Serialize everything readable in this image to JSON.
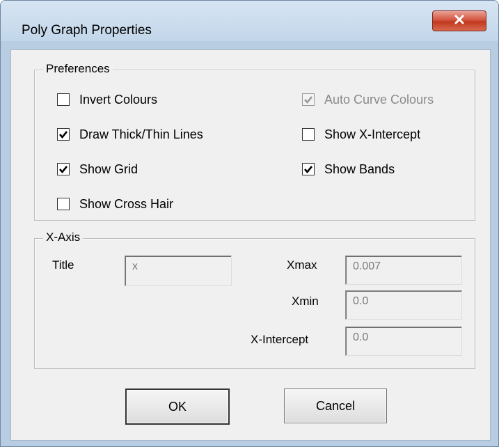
{
  "window": {
    "title": "Poly Graph Properties",
    "close_icon": "close-icon"
  },
  "preferences": {
    "legend": "Preferences",
    "checkboxes": [
      {
        "label": "Invert Colours",
        "checked": false,
        "enabled": true
      },
      {
        "label": "Draw Thick/Thin Lines",
        "checked": true,
        "enabled": true
      },
      {
        "label": "Show Grid",
        "checked": true,
        "enabled": true
      },
      {
        "label": "Show Cross Hair",
        "checked": false,
        "enabled": true
      },
      {
        "label": "Auto Curve Colours",
        "checked": true,
        "enabled": false
      },
      {
        "label": "Show X-Intercept",
        "checked": false,
        "enabled": true
      },
      {
        "label": "Show Bands",
        "checked": true,
        "enabled": true
      }
    ]
  },
  "x_axis": {
    "legend": "X-Axis",
    "title_label": "Title",
    "title_value": "x",
    "xmax_label": "Xmax",
    "xmax_value": "0.007",
    "xmin_label": "Xmin",
    "xmin_value": "0.0",
    "xintercept_label": "X-Intercept",
    "xintercept_value": "0.0"
  },
  "buttons": {
    "ok": "OK",
    "cancel": "Cancel"
  },
  "colors": {
    "close_button": "#c9452d",
    "dialog_bg": "#f0f0f0",
    "frame": "#b8cde2"
  }
}
